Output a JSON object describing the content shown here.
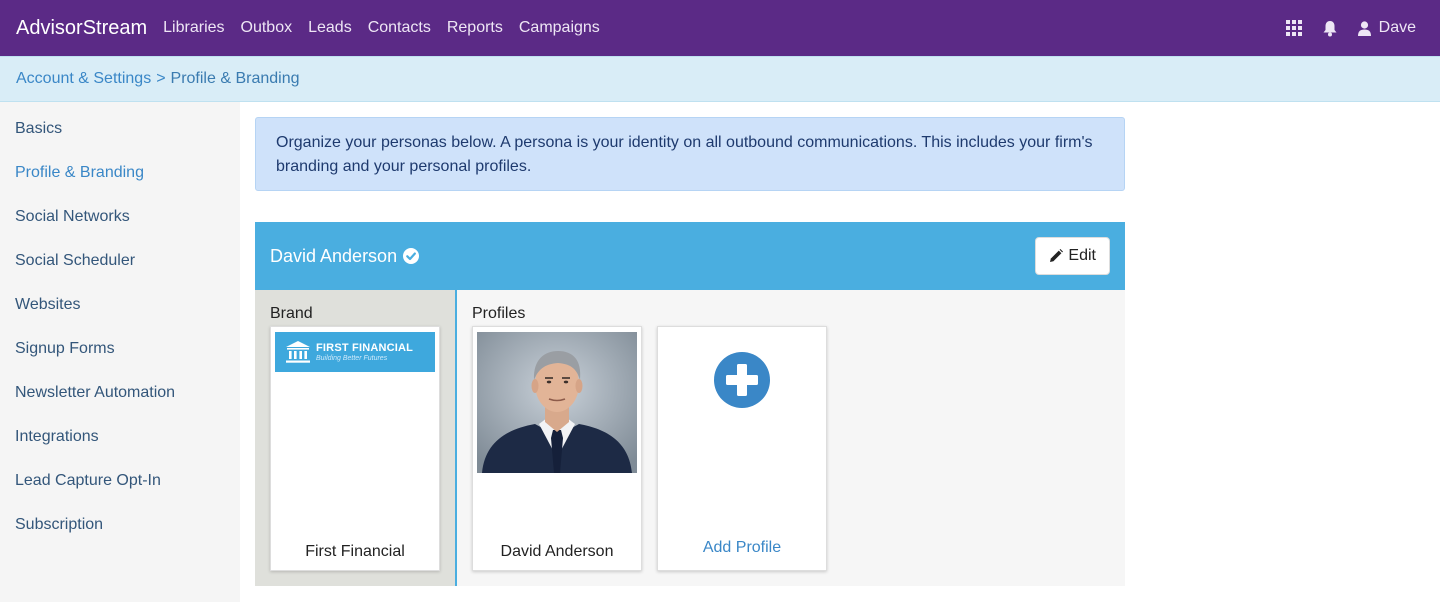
{
  "app": {
    "title": "AdvisorStream"
  },
  "nav": {
    "links": [
      "Libraries",
      "Outbox",
      "Leads",
      "Contacts",
      "Reports",
      "Campaigns"
    ],
    "user": "Dave",
    "icons": [
      "apps-grid-icon",
      "bell-icon",
      "user-icon"
    ]
  },
  "breadcrumb": {
    "parent": "Account & Settings",
    "separator": ">",
    "current": "Profile & Branding"
  },
  "sidebar": {
    "items": [
      {
        "label": "Basics"
      },
      {
        "label": "Profile & Branding",
        "active": true
      },
      {
        "label": "Social Networks"
      },
      {
        "label": "Social Scheduler"
      },
      {
        "label": "Websites"
      },
      {
        "label": "Signup Forms"
      },
      {
        "label": "Newsletter Automation"
      },
      {
        "label": "Integrations"
      },
      {
        "label": "Lead Capture Opt-In"
      },
      {
        "label": "Subscription"
      }
    ]
  },
  "info": {
    "text": "Organize your personas below. A persona is your identity on all outbound communications. This includes your firm's branding and your personal profiles."
  },
  "persona": {
    "name": "David Anderson",
    "edit_label": "Edit",
    "brand_title": "Brand",
    "profiles_title": "Profiles",
    "brand_card": {
      "logo_name": "FIRST FINANCIAL",
      "logo_tagline": "Building Better Futures",
      "label": "First Financial"
    },
    "profile_card": {
      "label": "David Anderson"
    },
    "add_card": {
      "label": "Add Profile"
    }
  },
  "colors": {
    "nav_bg": "#5b2a86",
    "breadcrumb_bg": "#d9edf7",
    "persona_header": "#4aaee0",
    "link": "#3a87c7",
    "info_bg": "#cfe2fa"
  }
}
